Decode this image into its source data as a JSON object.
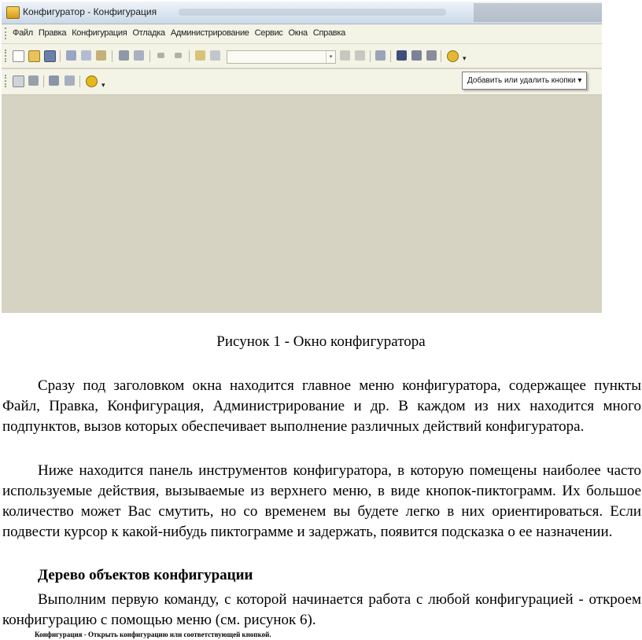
{
  "window": {
    "title": "Конфигуратор - Конфигурация",
    "menu": [
      "Файл",
      "Правка",
      "Конфигурация",
      "Отладка",
      "Администрирование",
      "Сервис",
      "Окна",
      "Справка"
    ],
    "tooltip": "Добавить или удалить кнопки ▾",
    "dropdown_glyph": "▾"
  },
  "caption": "Рисунок 1 - Окно конфигуратора",
  "paragraphs": [
    "Сразу под заголовком окна находится главное меню конфигуратора, содержащее пункты Файл, Правка, Конфигурация, Администрирование и др. В каждом из них находится много подпунктов, вызов которых обеспечивает выполнение различных действий конфигуратора.",
    "Ниже находится панель инструментов конфигуратора, в которую помещены наиболее часто используемые действия, вызываемые из верхнего меню, в виде кнопок-пиктограмм. Их большое количество может Вас смутить, но со временем вы будете легко в них ориентироваться. Если подвести курсор к какой-нибудь пиктограмме и задержать, появится подсказка о ее назначении."
  ],
  "heading": "Дерево объектов конфигурации",
  "paragraph3": "Выполним первую команду, с которой начинается работа с любой конфигурацией - откроем конфигурацию с помощью меню (см. рисунок 6).",
  "footnote": "Конфигурация - Открыть конфигурацию или соответствующей кнопкой.",
  "colors": {
    "workspace": "#d6d3c3",
    "toolbar": "#f3f3e6",
    "titlebar": "#d9e4ef"
  }
}
